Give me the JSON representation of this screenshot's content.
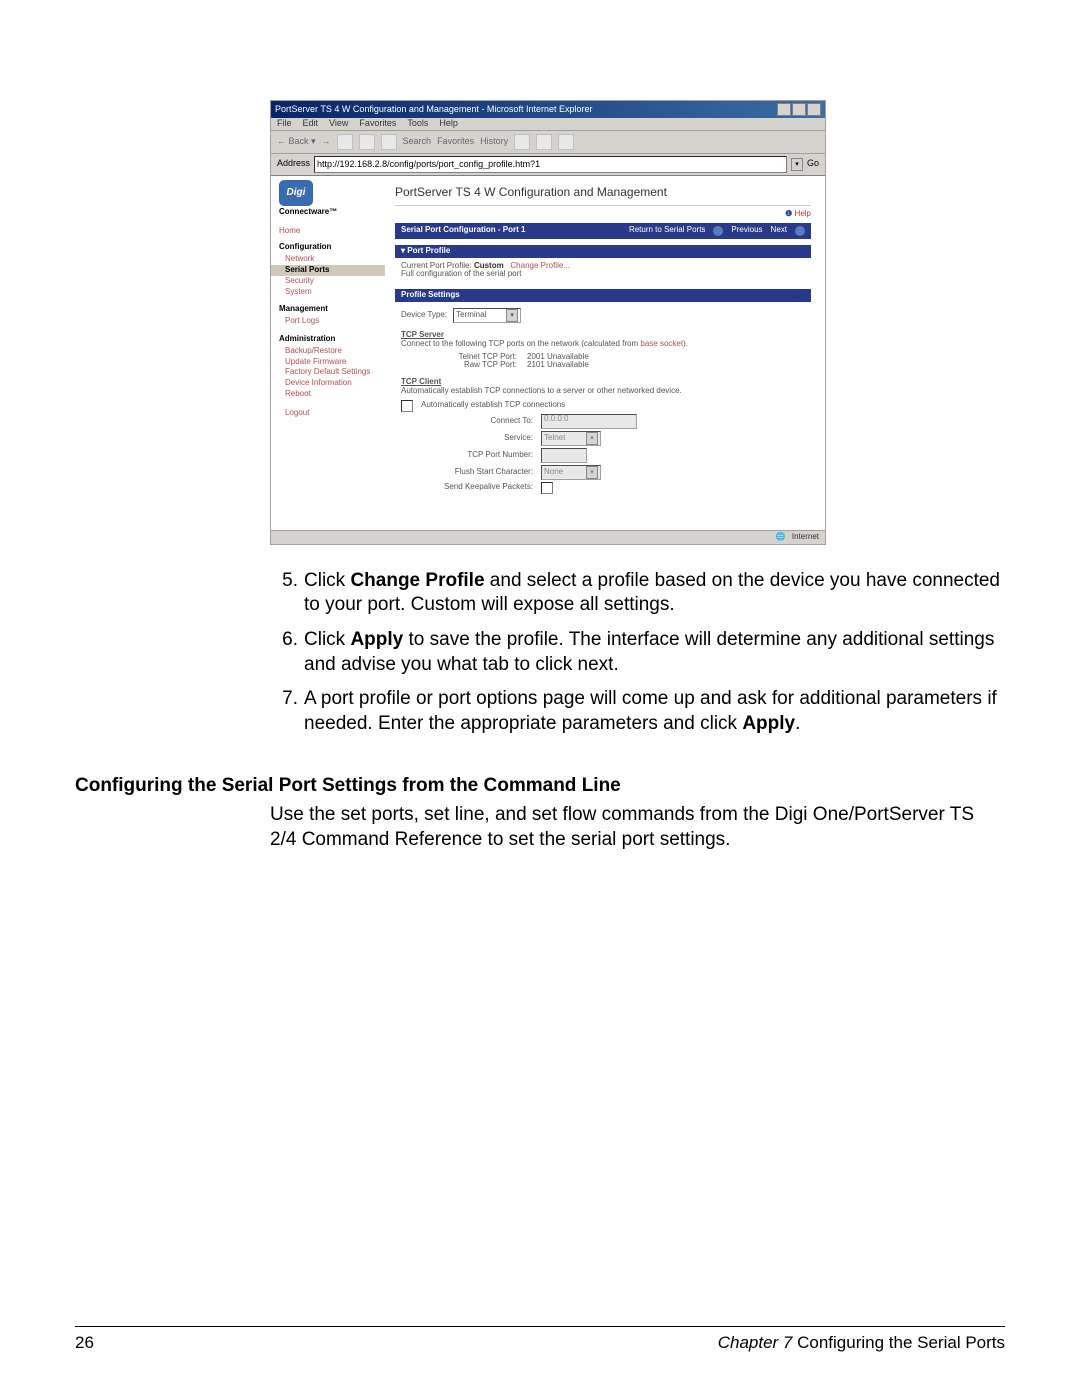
{
  "browser": {
    "title_text": "PortServer TS 4 W Configuration and Management - Microsoft Internet Explorer",
    "menu": [
      "File",
      "Edit",
      "View",
      "Favorites",
      "Tools",
      "Help"
    ],
    "toolbar_labels": {
      "search": "Search",
      "favorites": "Favorites",
      "history": "History"
    },
    "address_label": "Address",
    "url": "http://192.168.2.8/config/ports/port_config_profile.htm?1",
    "go_label": "Go",
    "status_left": "",
    "status_right": "Internet"
  },
  "digi": {
    "logo_text": "Digi",
    "connectware": "Connectware™",
    "nav": {
      "home": "Home",
      "config_title": "Configuration",
      "network": "Network",
      "serial_ports": "Serial Ports",
      "security": "Security",
      "system": "System",
      "mgmt_title": "Management",
      "port_logs": "Port Logs",
      "admin_title": "Administration",
      "backup": "Backup/Restore",
      "firmware": "Update Firmware",
      "factory": "Factory Default Settings",
      "devinfo": "Device Information",
      "reboot": "Reboot",
      "logout": "Logout"
    },
    "page_title": "PortServer TS 4 W Configuration and Management",
    "help_label": "Help",
    "section_header_left": "Serial Port Configuration - Port 1",
    "section_header_right": {
      "return": "Return to Serial Ports",
      "prev": "Previous",
      "next": "Next"
    },
    "port_profile_header": "▾ Port Profile",
    "current_profile_label": "Current Port Profile:",
    "current_profile_value": "Custom",
    "change_profile": "Change Profile...",
    "profile_desc": "Full configuration of the serial port",
    "profile_settings_header": "Profile Settings",
    "device_type_label": "Device Type:",
    "device_type_value": "Terminal",
    "tcp_server_title": "TCP Server",
    "tcp_server_text_a": "Connect to the following TCP ports on the network (calculated from ",
    "tcp_server_link": "base socket",
    "tcp_server_text_b": ").",
    "telnet_port_label": "Telnet TCP Port:",
    "telnet_port_value": "2001  Unavailable",
    "raw_port_label": "Raw TCP Port:",
    "raw_port_value": "2101  Unavailable",
    "tcp_client_title": "TCP Client",
    "tcp_client_text": "Automatically establish TCP connections to a server or other networked device.",
    "auto_conn_label": "Automatically establish TCP connections",
    "connect_to_label": "Connect To:",
    "connect_to_value": "0.0.0.0",
    "service_label": "Service:",
    "service_value": "Telnet",
    "tcp_port_num_label": "TCP Port Number:",
    "flush_label": "Flush Start Character:",
    "flush_value": "None",
    "keepalive_label": "Send Keepalive Packets:"
  },
  "doc": {
    "item5_a": "Click ",
    "item5_b": "Change Profile",
    "item5_c": " and select a profile based on the device you have connected to your port. Custom will expose all settings.",
    "item6_a": "Click ",
    "item6_b": "Apply",
    "item6_c": " to save the profile. The interface will determine any additional settings and advise you what tab to click next.",
    "item7_a": "A port profile or port options page will come up and ask for additional parameters if needed. Enter the appropriate parameters and click ",
    "item7_b": "Apply",
    "item7_c": ".",
    "section2_title": "Configuring the Serial Port Settings from the Command Line",
    "section2_body": "Use the set ports, set line, and set flow commands from the Digi One/PortServer TS 2/4 Command Reference to set the serial port settings.",
    "footer_page": "26",
    "footer_chapter": "Chapter 7",
    "footer_title": "   Configuring the Serial Ports"
  }
}
